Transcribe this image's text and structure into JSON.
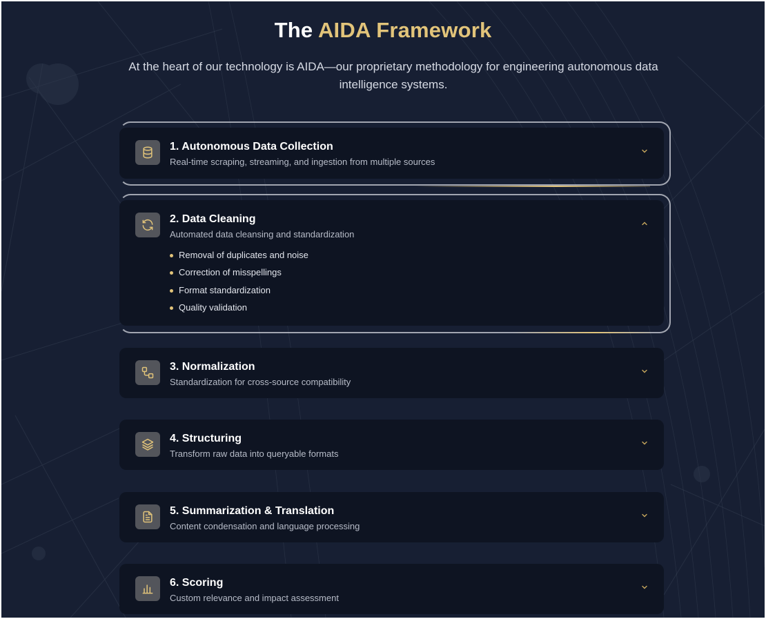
{
  "header": {
    "title_prefix": "The ",
    "title_accent": "AIDA Framework",
    "subtitle": "At the heart of our technology is AIDA—our proprietary methodology for engineering autonomous data intelligence systems."
  },
  "colors": {
    "background": "#172033",
    "card": "#0e1422",
    "accent_gold": "#e2c47a",
    "icon_tile": "#53555b"
  },
  "steps": [
    {
      "title": "1. Autonomous Data Collection",
      "description": "Real-time scraping, streaming, and ingestion from multiple sources",
      "icon": "database-icon",
      "expanded": false
    },
    {
      "title": "2. Data Cleaning",
      "description": "Automated data cleansing and standardization",
      "icon": "refresh-icon",
      "expanded": true,
      "details": [
        "Removal of duplicates and noise",
        "Correction of misspellings",
        "Format standardization",
        "Quality validation"
      ]
    },
    {
      "title": "3. Normalization",
      "description": "Standardization for cross-source compatibility",
      "icon": "workflow-icon",
      "expanded": false
    },
    {
      "title": "4. Structuring",
      "description": "Transform raw data into queryable formats",
      "icon": "layers-icon",
      "expanded": false
    },
    {
      "title": "5. Summarization & Translation",
      "description": "Content condensation and language processing",
      "icon": "document-icon",
      "expanded": false
    },
    {
      "title": "6. Scoring",
      "description": "Custom relevance and impact assessment",
      "icon": "bar-chart-icon",
      "expanded": false
    }
  ]
}
